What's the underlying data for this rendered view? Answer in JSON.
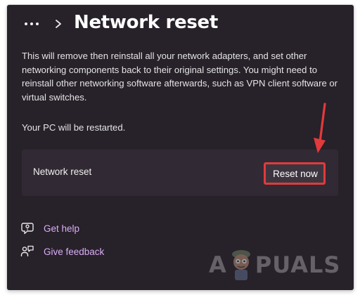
{
  "header": {
    "more_icon": "more-horizontal-icon",
    "chevron_icon": "chevron-right-icon",
    "title": "Network reset"
  },
  "main": {
    "description": "This will remove then reinstall all your network adapters, and set other networking components back to their original settings. You might need to reinstall other networking software afterwards, such as VPN client software or virtual switches.",
    "restart_note": "Your PC will be restarted."
  },
  "setting": {
    "label": "Network reset",
    "button_label": "Reset now"
  },
  "links": [
    {
      "icon": "help-icon",
      "label": "Get help"
    },
    {
      "icon": "feedback-icon",
      "label": "Give feedback"
    }
  ],
  "annotation": {
    "highlight_color": "#e23a3a",
    "arrow_color": "#e23a3a"
  },
  "watermark": {
    "left_text": "A",
    "right_text": "PUALS"
  },
  "colors": {
    "window_bg": "#27212a",
    "card_bg": "#312a34",
    "link_color": "#d9aef6"
  }
}
